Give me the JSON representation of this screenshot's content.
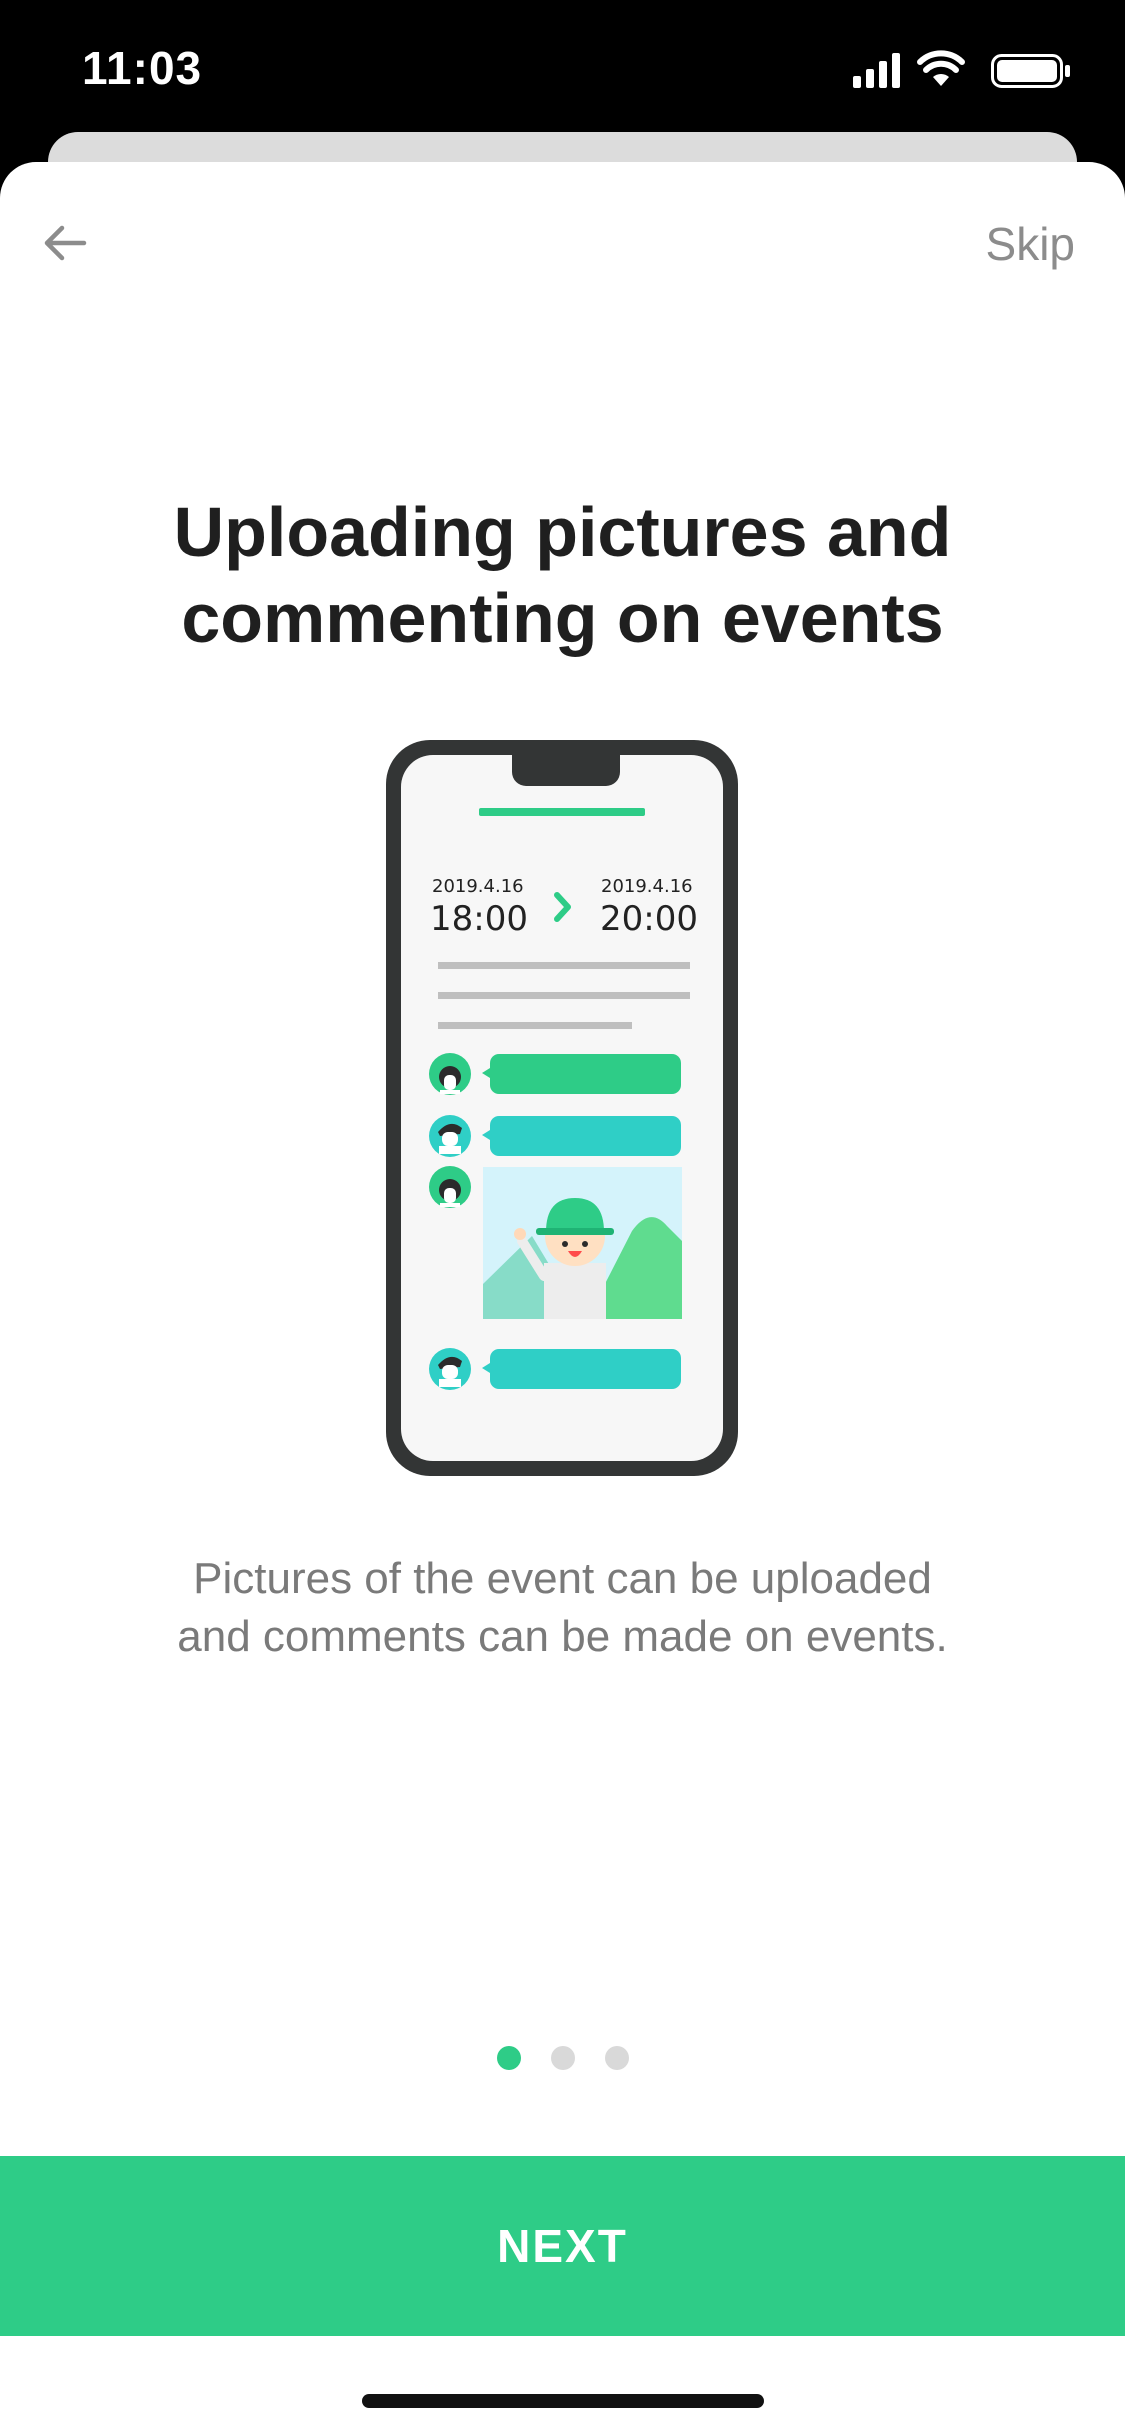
{
  "status_bar": {
    "time": "11:03"
  },
  "nav": {
    "back_icon": "arrow-left-icon",
    "skip_label": "Skip"
  },
  "content": {
    "title": "Uploading pictures and\ncommenting on events",
    "description": "Pictures of the event can be uploaded\nand comments can be made on events."
  },
  "illustration": {
    "start_date": "2019.4.16",
    "start_time": "18:00",
    "end_date": "2019.4.16",
    "end_time": "20:00"
  },
  "pager": {
    "total": 3,
    "active_index": 0
  },
  "footer": {
    "next_label": "NEXT"
  },
  "colors": {
    "accent": "#2ecc87",
    "teal": "#2fcfc6",
    "title": "#1f1f1f",
    "muted": "#8c8c8c"
  }
}
